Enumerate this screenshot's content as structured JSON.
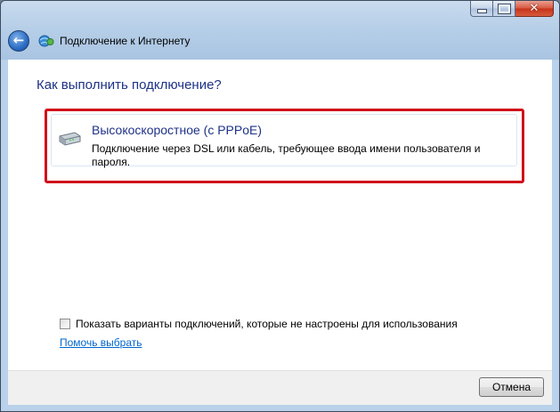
{
  "window": {
    "title": "Подключение к Интернету",
    "caption_buttons": {
      "minimize_icon": "minimize-icon",
      "maximize_icon": "maximize-icon",
      "close_icon": "close-icon",
      "close_glyph": "✕"
    },
    "back_icon": "back-arrow-icon",
    "back_glyph": "←",
    "app_icon": "network-globe-icon"
  },
  "main": {
    "heading": "Как выполнить подключение?",
    "options": [
      {
        "icon": "broadband-modem-icon",
        "title": "Высокоскоростное (с PPPoE)",
        "description": "Подключение через DSL или кабель, требующее ввода имени пользователя и пароля."
      }
    ],
    "highlight_color": "#d0101a",
    "show_unconfigured": {
      "label": "Показать варианты подключений, которые не настроены для использования",
      "checked": false
    },
    "help_link": "Помочь выбрать"
  },
  "footer": {
    "cancel_label": "Отмена"
  },
  "colors": {
    "heading": "#1e3287",
    "link": "#0066cc",
    "close_button": "#c6321a"
  }
}
